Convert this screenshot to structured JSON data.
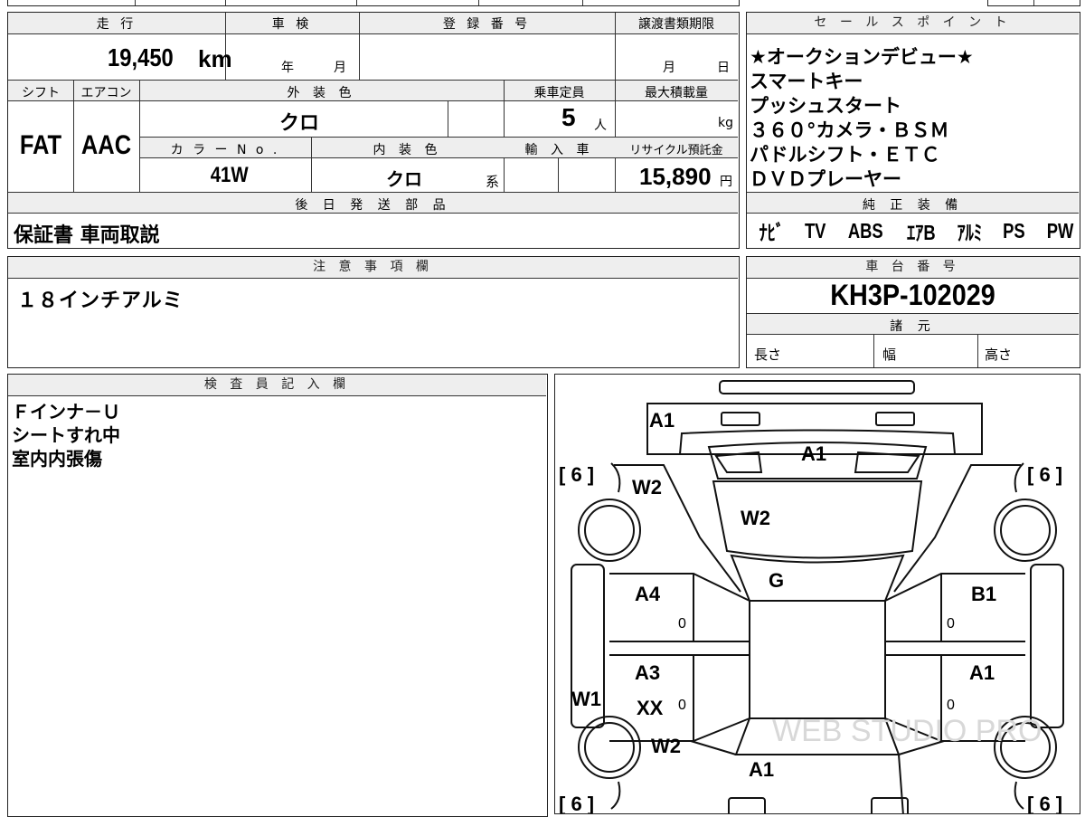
{
  "specs": {
    "mileage_label": "走 行",
    "mileage": "19,450",
    "mileage_unit": "km",
    "inspection_label": "車 検",
    "year_unit": "年",
    "month_unit": "月",
    "registration_label": "登 録 番 号",
    "transfer_label": "譲渡書類期限",
    "transfer_month": "月",
    "transfer_day": "日",
    "shift_label": "シフト",
    "shift": "FAT",
    "ac_label": "エアコン",
    "ac": "AAC",
    "exterior_label": "外 装 色",
    "exterior": "クロ",
    "color_no_label": "カ ラ ー N o .",
    "color_no": "41W",
    "interior_label": "内 装 色",
    "interior": "クロ",
    "interior_suffix": "系",
    "capacity_label": "乗車定員",
    "capacity": "5",
    "capacity_unit": "人",
    "maxload_label": "最大積載量",
    "maxload_unit": "kg",
    "import_label": "輸 入 車",
    "recycle_label": "リサイクル預託金",
    "recycle": "15,890",
    "recycle_unit": "円",
    "later_label": "後 日 発 送 部 品",
    "later_items": "保証書 車両取説"
  },
  "sales": {
    "label": "セ ー ル ス ポ イ ン ト",
    "lines": [
      "★オークションデビュー★",
      "スマートキー",
      "プッシュスタート",
      "３６０°カメラ・ＢＳＭ",
      "パドルシフト・ＥＴＣ",
      "ＤＶＤプレーヤー"
    ]
  },
  "equipment": {
    "label": "純 正 装 備",
    "items": [
      "ﾅﾋﾞ",
      "TV",
      "ABS",
      "ｴｱB",
      "ｱﾙﾐ",
      "PS",
      "PW"
    ]
  },
  "notes": {
    "label": "注 意 事 項 欄",
    "text": "１８インチアルミ"
  },
  "chassis": {
    "label": "車 台 番 号",
    "number": "KH3P-102029",
    "spec_label": "諸 元",
    "length_label": "長さ",
    "width_label": "幅",
    "height_label": "高さ"
  },
  "inspector": {
    "label": "検 査 員 記 入 欄",
    "lines": [
      "Ｆインナ－Ｕ",
      "シートすれ中",
      "室内内張傷"
    ]
  },
  "diagram": {
    "labels": {
      "front_bumper": "A1",
      "hood": "A1",
      "windshield": "W2",
      "front_left_window": "W2",
      "roof": "G",
      "front_left_door": "A4",
      "rear_left_door": "A3",
      "rear_left_door_extra": "XX",
      "left_side_glass": "W1",
      "rear_left_window": "W2",
      "trunk": "A1",
      "front_right_door": "B1",
      "rear_right_door": "A1",
      "door_marks": [
        "0",
        "0",
        "0",
        "0"
      ]
    },
    "tires": [
      "[ 6 ]",
      "[ 6 ]",
      "[ 6 ]",
      "[ 6 ]"
    ],
    "watermark": "WEB STUDIO PRO"
  }
}
